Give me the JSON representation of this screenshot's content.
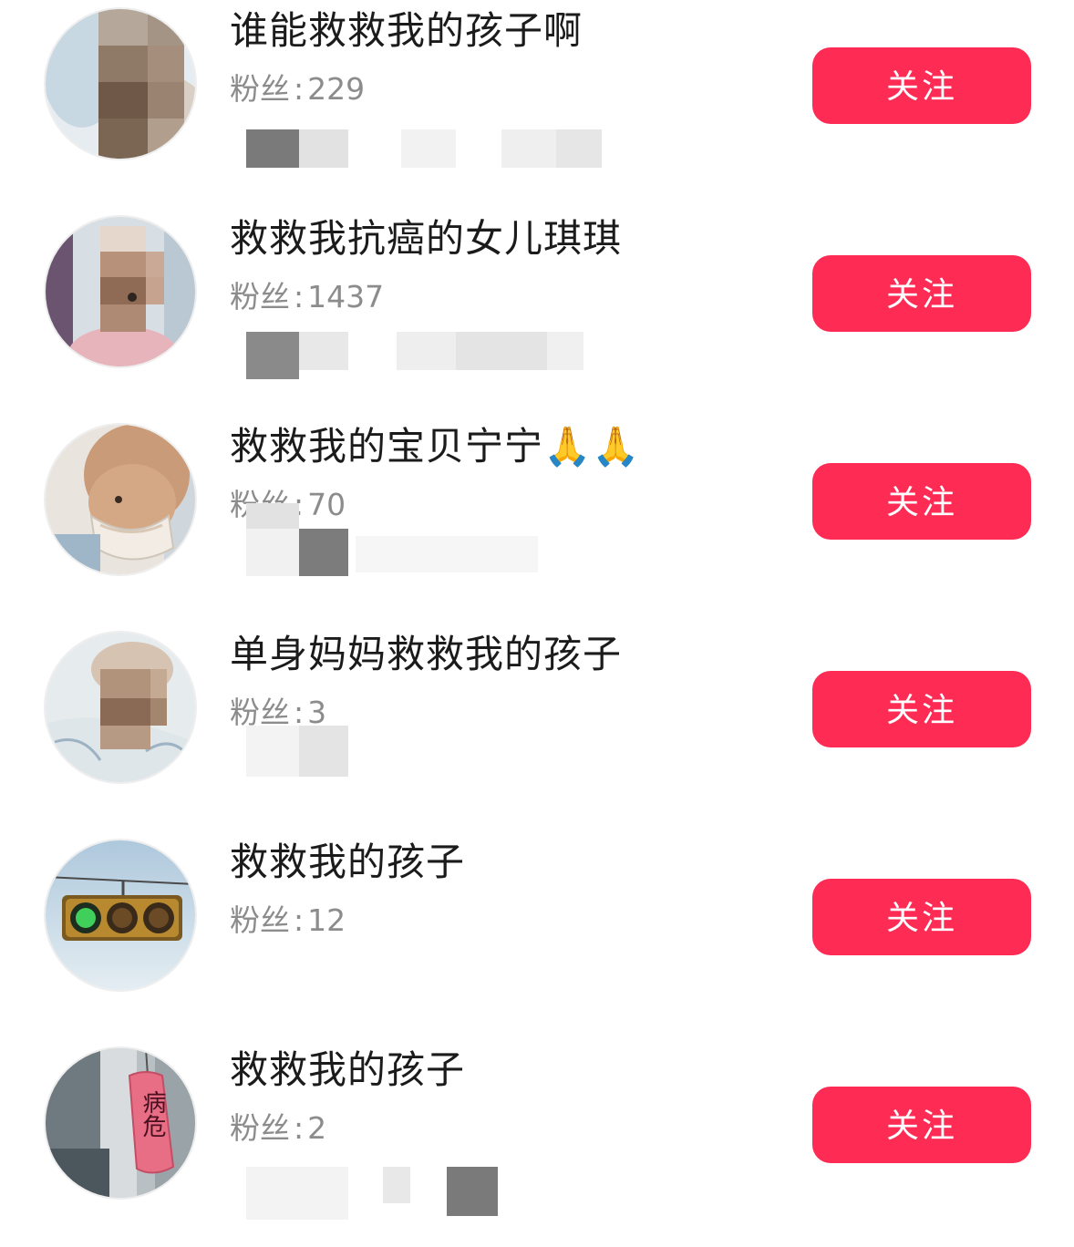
{
  "follow_label": "关注",
  "fans_prefix": "粉丝",
  "fans_separator": ":",
  "accent_color": "#fe2c55",
  "accounts": [
    {
      "name": "谁能救救我的孩子啊",
      "fans": "229",
      "avatar": "pixelated-baby-photo-icon"
    },
    {
      "name": "救救我抗癌的女儿琪琪",
      "fans": "1437",
      "avatar": "pixelated-child-in-hospital-icon"
    },
    {
      "name": "救救我的宝贝宁宁",
      "name_emoji": "🙏🙏",
      "fans": "70",
      "avatar": "bald-child-with-mask-icon"
    },
    {
      "name": "单身妈妈救救我的孩子",
      "fans": "3",
      "avatar": "pixelated-baby-blanket-icon"
    },
    {
      "name": "救救我的孩子",
      "fans": "12",
      "avatar": "traffic-light-icon"
    },
    {
      "name": "救救我的孩子",
      "fans": "2",
      "avatar": "critical-condition-tag-icon",
      "avatar_tag": "病危"
    }
  ]
}
